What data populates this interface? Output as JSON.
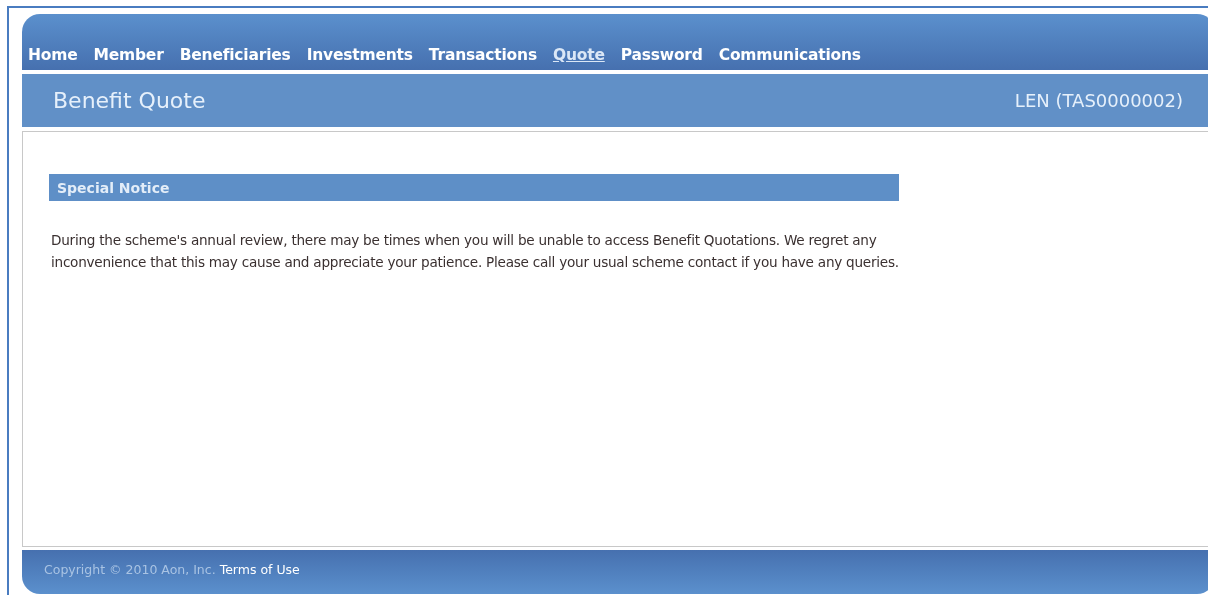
{
  "nav": [
    {
      "label": "Home",
      "selected": false
    },
    {
      "label": "Member",
      "selected": false
    },
    {
      "label": "Beneficiaries",
      "selected": false
    },
    {
      "label": "Investments",
      "selected": false
    },
    {
      "label": "Transactions",
      "selected": false
    },
    {
      "label": "Quote",
      "selected": true
    },
    {
      "label": "Password",
      "selected": false
    },
    {
      "label": "Communications",
      "selected": false
    }
  ],
  "page_title": "Benefit Quote",
  "member": "LEN (TAS0000002)",
  "notice": {
    "heading": "Special Notice",
    "text": "During the scheme's annual review, there may be times when you will be unable to access Benefit Quotations. We regret any inconvenience that this may cause and appreciate your patience. Please call your usual scheme contact if you have any queries."
  },
  "footer": {
    "copyright": "Copyright © 2010 Aon, Inc.",
    "link": "Terms of Use"
  }
}
